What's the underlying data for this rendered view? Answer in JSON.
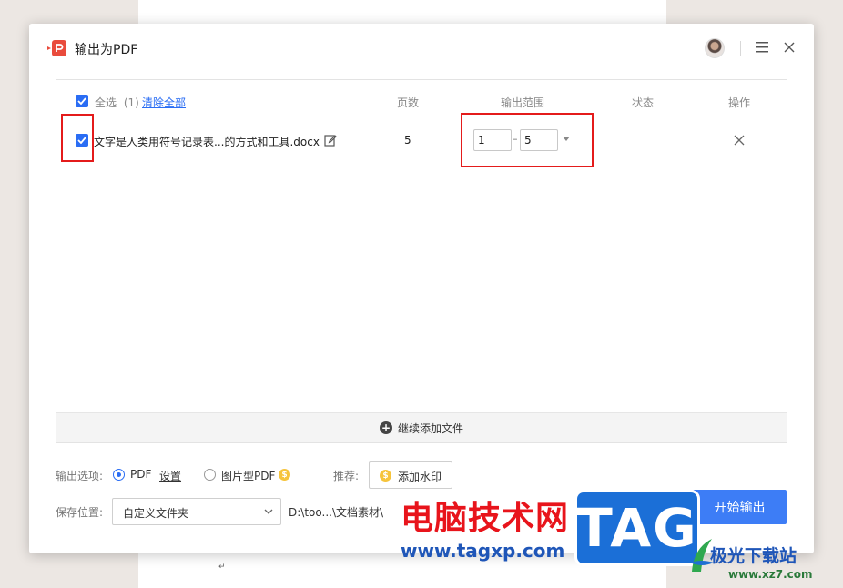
{
  "dialog": {
    "title": "输出为PDF"
  },
  "table": {
    "select_all_label": "全选",
    "select_count": "(1)",
    "clear_all_label": "清除全部",
    "columns": {
      "pages": "页数",
      "range": "输出范围",
      "status": "状态",
      "action": "操作"
    },
    "rows": [
      {
        "filename": "文字是人类用符号记录表...的方式和工具.docx",
        "pages": "5",
        "range_from": "1",
        "range_to": "5",
        "status": ""
      }
    ],
    "add_more_label": "继续添加文件"
  },
  "options": {
    "output_label": "输出选项:",
    "pdf_label": "PDF",
    "settings_label": "设置",
    "image_pdf_label": "图片型PDF",
    "selected": "PDF",
    "recommend_label": "推荐:",
    "watermark_label": "添加水印",
    "save_location_label": "保存位置:",
    "save_location_value": "自定义文件夹",
    "save_path": "D:\\too...\\文档素材\\"
  },
  "start_button_label": "开始输出",
  "watermarks": {
    "site_name": "电脑技术网",
    "site_url": "www.tagxp.com",
    "tag_logo": "TAG",
    "xz7_name": "极光下载站",
    "xz7_url": "www.xz7.com"
  },
  "document": {
    "paragraph_mark": "↵"
  },
  "colors": {
    "accent": "#2a6df4",
    "start_button": "#3d7df6",
    "highlight": "#e41b1b"
  }
}
